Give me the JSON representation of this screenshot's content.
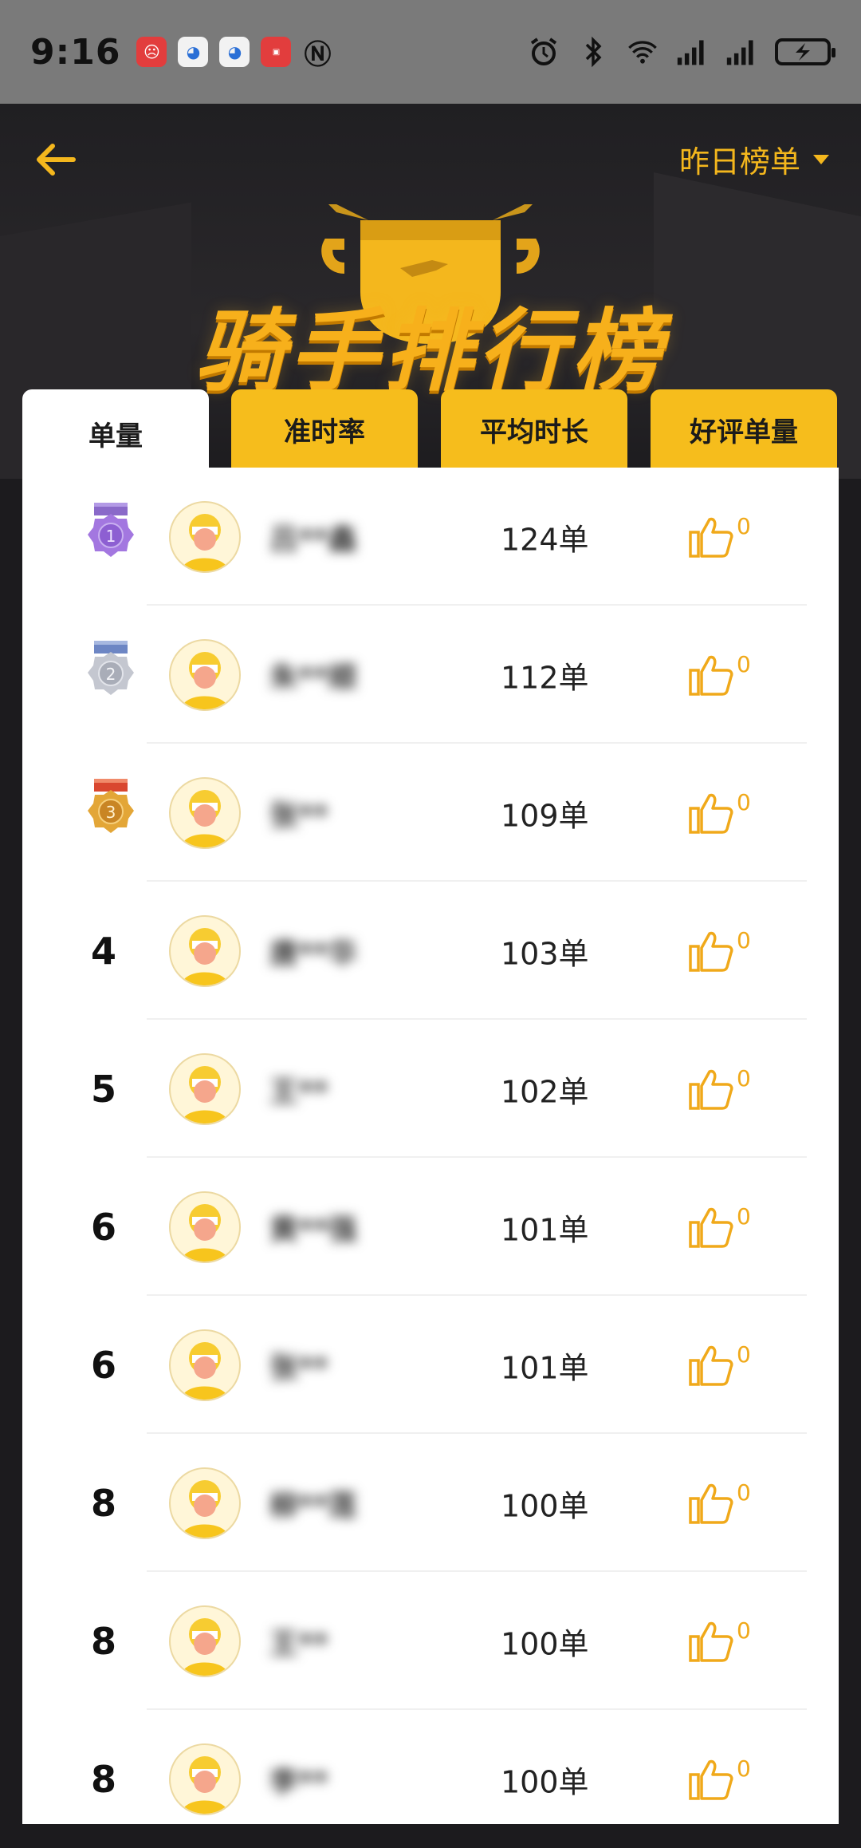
{
  "status_bar": {
    "time": "9:16",
    "icons": [
      "app-red-icon",
      "app-blue-1-icon",
      "app-blue-2-icon",
      "huawei-store-icon",
      "nfc-icon",
      "alarm-icon",
      "bluetooth-icon",
      "wifi-icon",
      "signal-icon",
      "signal-icon",
      "battery-charging-icon"
    ]
  },
  "header": {
    "list_selector": "昨日榜单",
    "title": "骑手排行榜"
  },
  "tabs": [
    {
      "label": "单量",
      "active": true
    },
    {
      "label": "准时率",
      "active": false
    },
    {
      "label": "平均时长",
      "active": false
    },
    {
      "label": "好评单量",
      "active": false
    }
  ],
  "rows": [
    {
      "rank": "1",
      "medal": "gold-purple",
      "name": "吕**鑫",
      "count": "124单",
      "likes": "0"
    },
    {
      "rank": "2",
      "medal": "silver",
      "name": "朱**顺",
      "count": "112单",
      "likes": "0"
    },
    {
      "rank": "3",
      "medal": "bronze",
      "name": "张**",
      "count": "109单",
      "likes": "0"
    },
    {
      "rank": "4",
      "medal": "",
      "name": "唐**华",
      "count": "103单",
      "likes": "0"
    },
    {
      "rank": "5",
      "medal": "",
      "name": "王**",
      "count": "102单",
      "likes": "0"
    },
    {
      "rank": "6",
      "medal": "",
      "name": "黄**强",
      "count": "101单",
      "likes": "0"
    },
    {
      "rank": "6",
      "medal": "",
      "name": "张**",
      "count": "101单",
      "likes": "0"
    },
    {
      "rank": "8",
      "medal": "",
      "name": "柳**莲",
      "count": "100单",
      "likes": "0"
    },
    {
      "rank": "8",
      "medal": "",
      "name": "王**",
      "count": "100单",
      "likes": "0"
    },
    {
      "rank": "8",
      "medal": "",
      "name": "李**",
      "count": "100单",
      "likes": "0"
    }
  ],
  "colors": {
    "accent": "#f6bd1c",
    "like": "#f0a91a",
    "status_bar": "#7a7a7a"
  }
}
